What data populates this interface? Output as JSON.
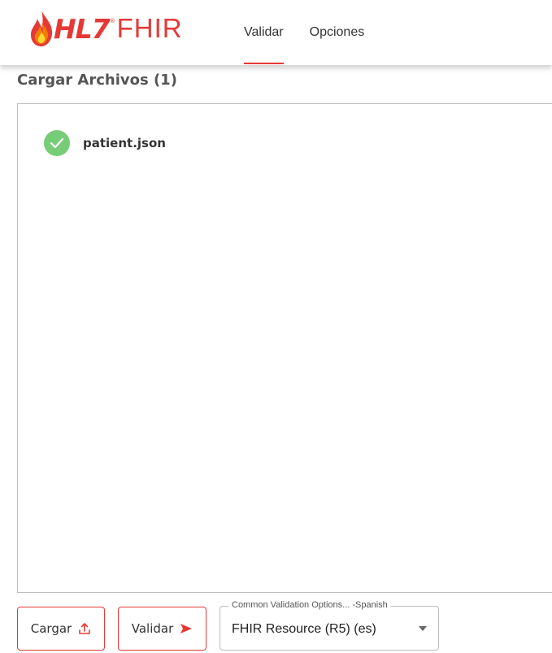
{
  "header": {
    "logo": {
      "brand": "HL7",
      "registered": "®",
      "product": "FHIR"
    },
    "tabs": [
      {
        "label": "Validar",
        "active": true
      },
      {
        "label": "Opciones",
        "active": false
      }
    ]
  },
  "upload_section": {
    "title": "Cargar Archivos (1)",
    "files": [
      {
        "name": "patient.json",
        "status": "valid",
        "status_icon": "check-circle-icon"
      }
    ]
  },
  "toolbar": {
    "upload_label": "Cargar",
    "upload_icon": "upload-icon",
    "validate_label": "Validar",
    "validate_icon": "send-arrow-icon"
  },
  "preset_select": {
    "label": "Common Validation Options... -Spanish",
    "value": "FHIR Resource (R5) (es)",
    "icon": "chevron-down-icon"
  },
  "colors": {
    "accent": "#e53935",
    "success": "#77cc77",
    "border": "#bdbdbd",
    "text": "#333333"
  }
}
